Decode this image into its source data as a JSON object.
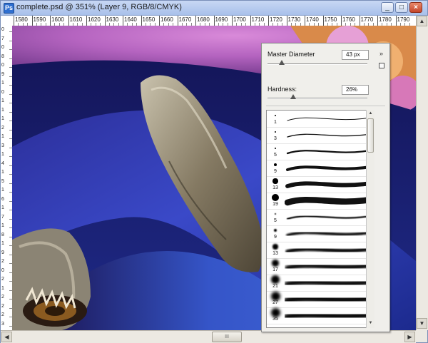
{
  "window": {
    "title": "complete.psd @ 351% (Layer 9, RGB/8/CMYK)",
    "app_icon": "photoshop-document-icon",
    "buttons": [
      "minimize",
      "maximize",
      "close"
    ]
  },
  "ruler_top": {
    "labels": [
      "1580",
      "1590",
      "1600",
      "1610",
      "1620",
      "1630",
      "1640",
      "1650",
      "1660",
      "1670",
      "1680",
      "1690",
      "1700",
      "1710",
      "1720",
      "1730",
      "1740",
      "1750",
      "1760",
      "1770",
      "1780",
      "1790"
    ]
  },
  "ruler_left": {
    "labels": [
      "0",
      "7",
      "0",
      "8",
      "0",
      "9",
      "1",
      "0",
      "1",
      "1",
      "1",
      "2",
      "1",
      "3",
      "1",
      "4",
      "1",
      "5",
      "1",
      "6",
      "1",
      "7",
      "1",
      "8",
      "1",
      "9",
      "2",
      "0",
      "2",
      "1",
      "2",
      "2",
      "2",
      "3"
    ]
  },
  "brush_panel": {
    "master_diameter_label": "Master Diameter",
    "master_diameter_value": "43 px",
    "master_diameter_fraction": 0.14,
    "hardness_label": "Hardness:",
    "hardness_value": "26%",
    "hardness_fraction": 0.26,
    "flyout_icon": "panel-menu-icon",
    "new_brush_icon": "new-brush-preset-icon",
    "presets": [
      {
        "number": "1"
      },
      {
        "number": "3"
      },
      {
        "number": "5"
      },
      {
        "number": "9"
      },
      {
        "number": "13"
      },
      {
        "number": "19"
      },
      {
        "number": "5"
      },
      {
        "number": "9"
      },
      {
        "number": "13"
      },
      {
        "number": "17"
      },
      {
        "number": "21"
      },
      {
        "number": "27"
      },
      {
        "number": "35"
      }
    ]
  },
  "scrollbars": {
    "horizontal_thumb_grip": "III",
    "scroll_left_icon": "arrow-left-icon",
    "scroll_right_icon": "arrow-right-icon",
    "scroll_up_icon": "arrow-up-icon",
    "scroll_down_icon": "arrow-down-icon"
  }
}
